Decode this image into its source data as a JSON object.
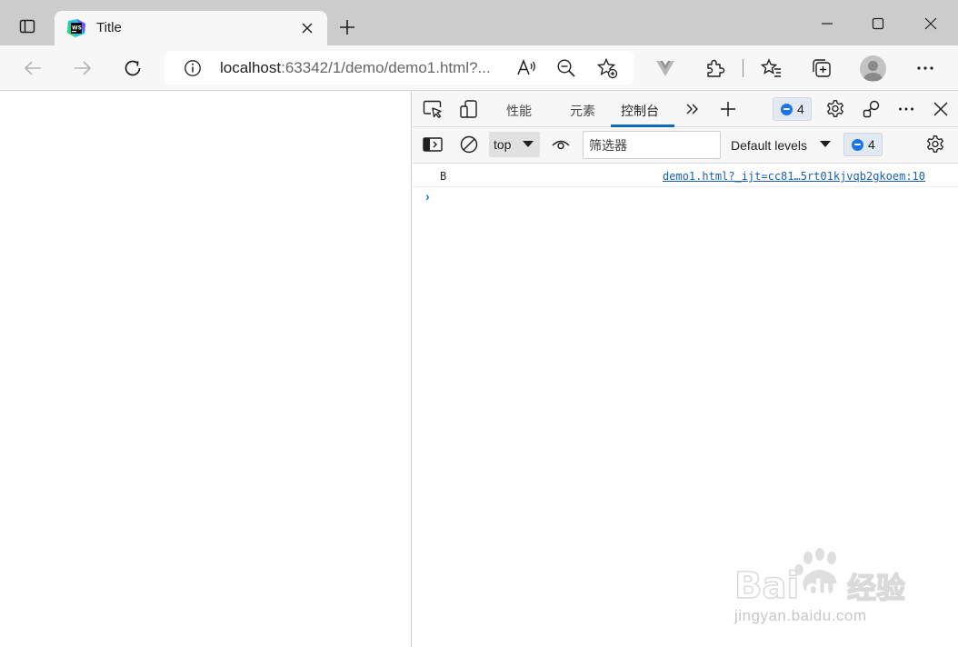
{
  "colors": {
    "titlebar_bg": "#cccccc",
    "toolbar_bg": "#f7f7f7",
    "accent": "#0f6cbd",
    "link": "#1a5fb4"
  },
  "browser": {
    "tab": {
      "title": "Title",
      "favicon": "webstorm-icon"
    },
    "address": {
      "host": "localhost",
      "rest": ":63342/1/demo/demo1.html?..."
    }
  },
  "devtools": {
    "tabs": [
      {
        "label": "性能",
        "active": false
      },
      {
        "label": "元素",
        "active": false
      },
      {
        "label": "控制台",
        "active": true
      }
    ],
    "issues_count": "4",
    "console": {
      "context": "top",
      "filter_placeholder": "筛选器",
      "levels_label": "Default levels",
      "messages_count": "4",
      "rows": [
        {
          "text": "B",
          "source": "demo1.html?_ijt=cc81…5rt01kjvqb2gkoem:10"
        }
      ],
      "prompt_symbol": "›"
    }
  },
  "watermark": {
    "text": "Bai du 经验",
    "url": "jingyan.baidu.com"
  }
}
